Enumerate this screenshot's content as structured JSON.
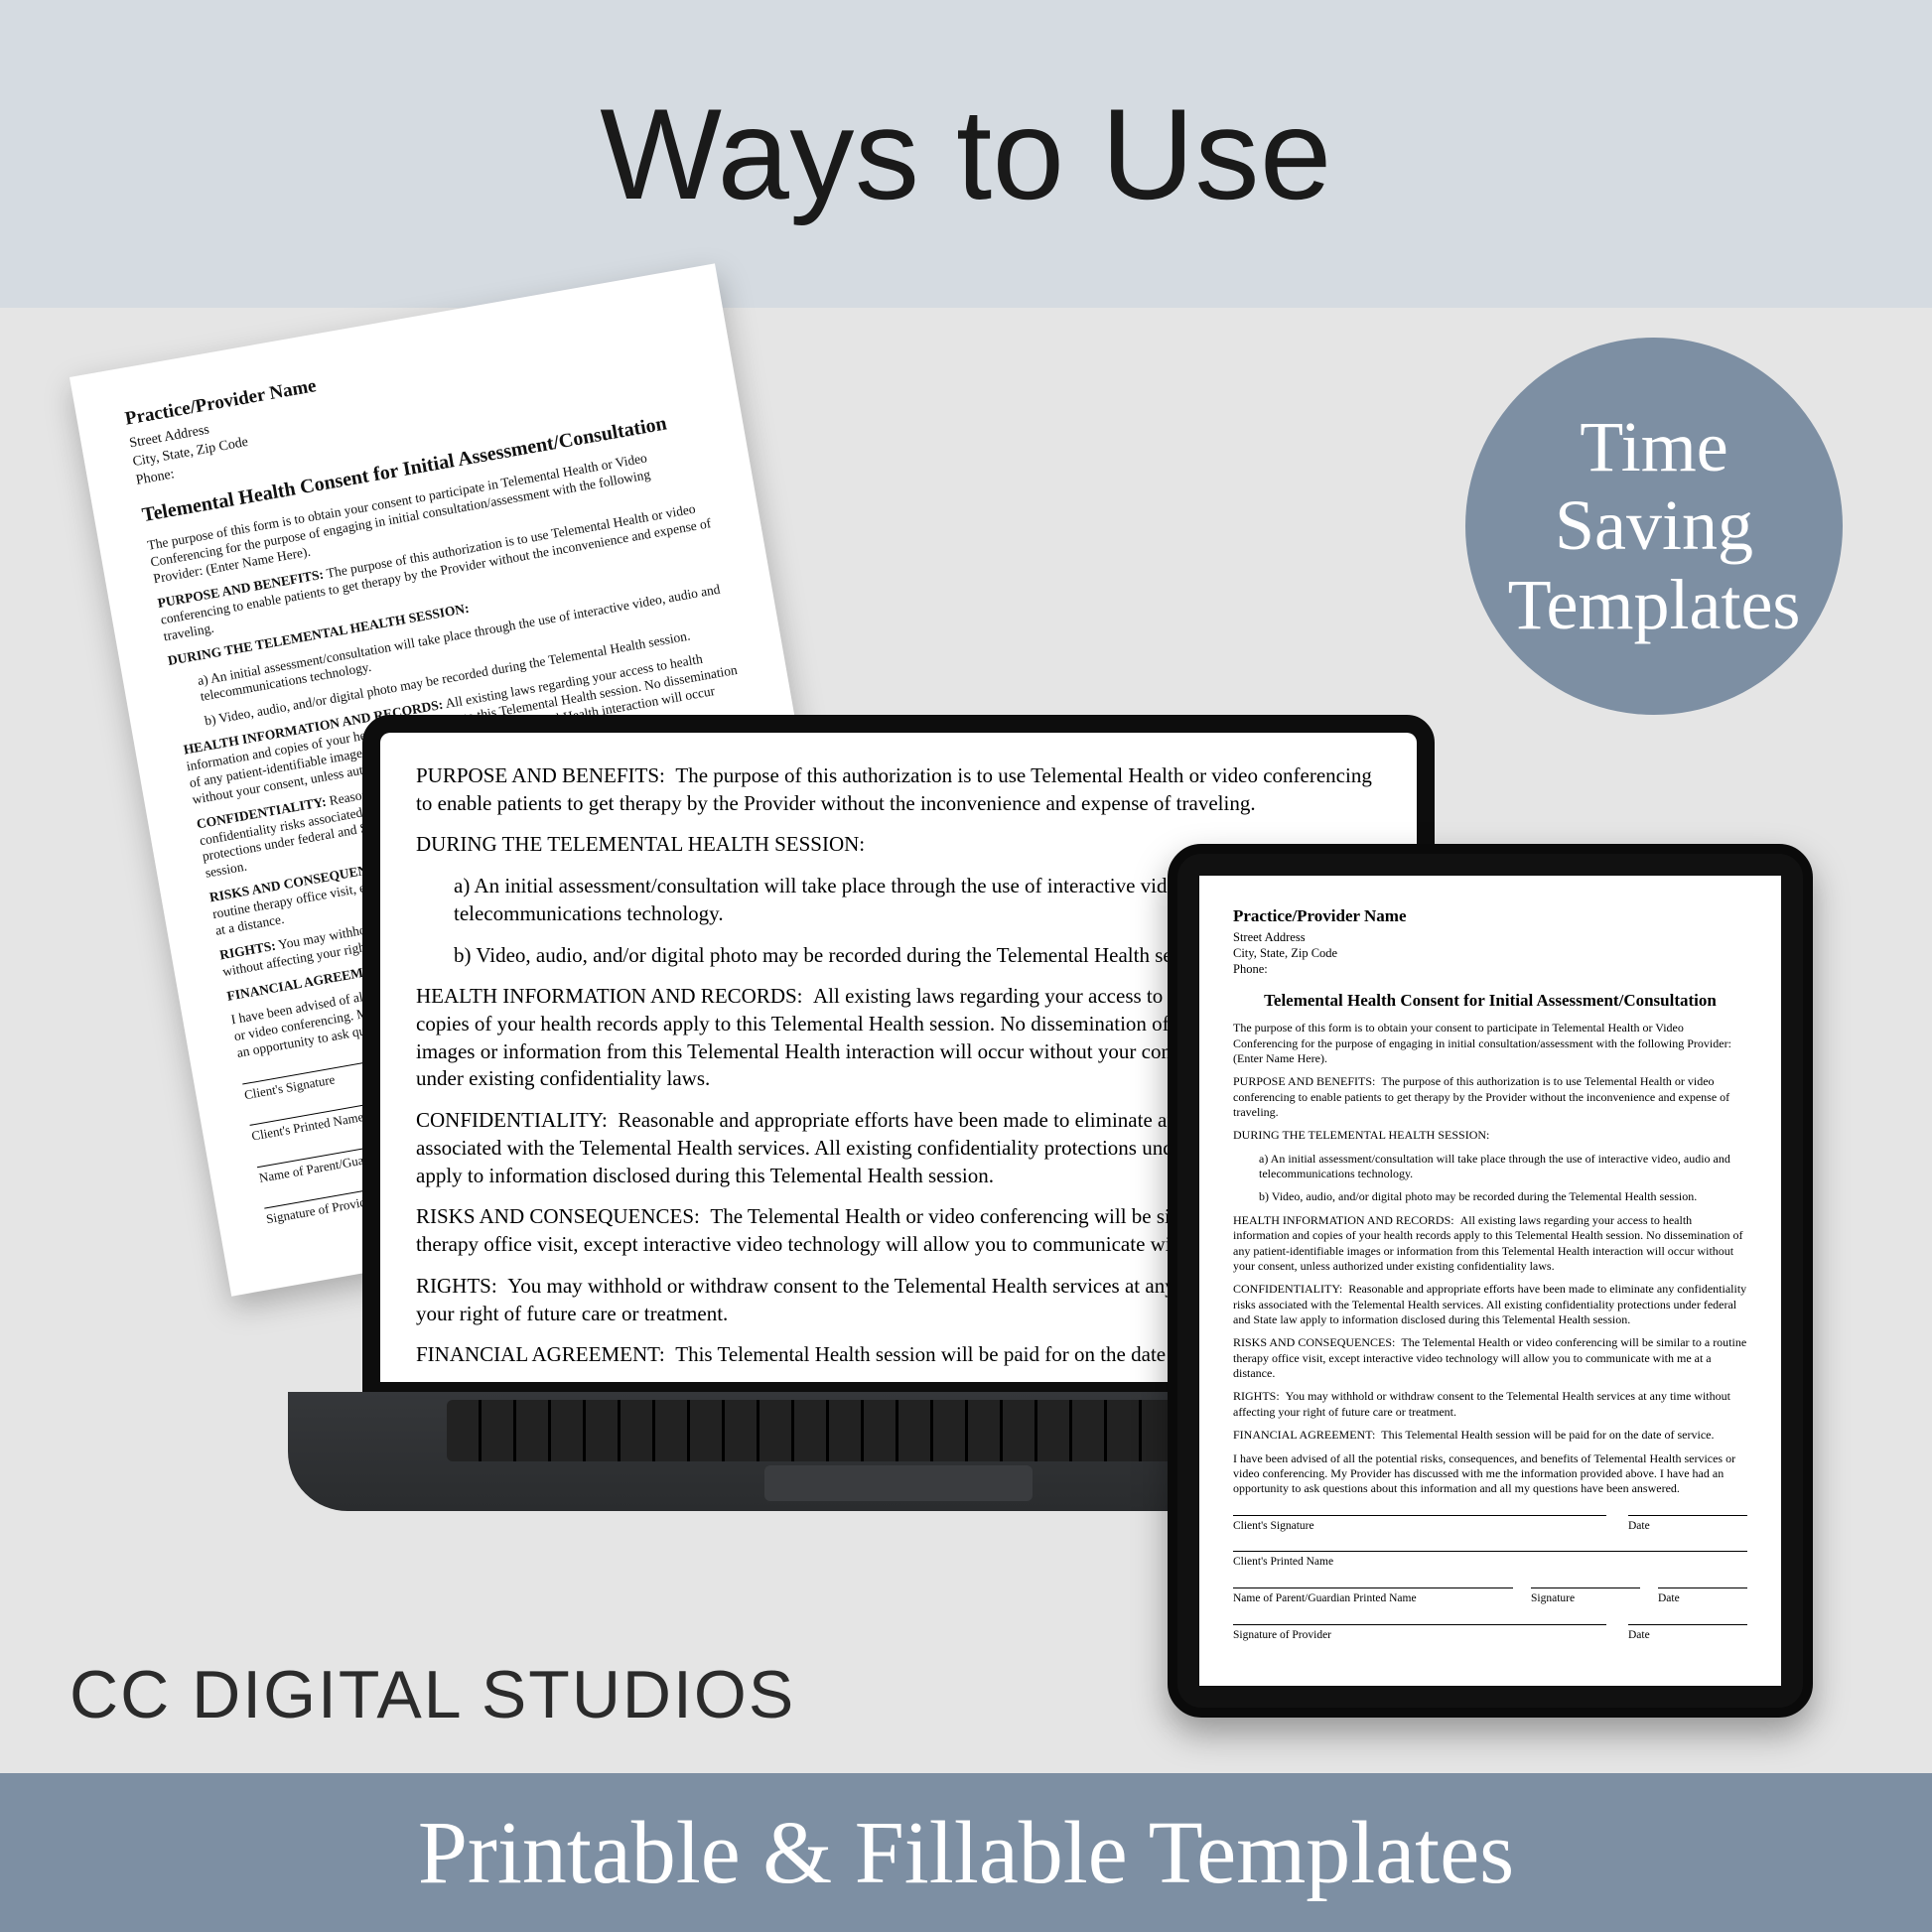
{
  "header": {
    "title": "Ways to Use"
  },
  "badge": {
    "line1": "Time",
    "line2": "Saving",
    "line3": "Templates"
  },
  "brand": "CC DIGITAL STUDIOS",
  "footer": "Printable & Fillable Templates",
  "doc": {
    "provider_heading": "Practice/Provider Name",
    "addr1": "Street Address",
    "addr2": "City, State, Zip Code",
    "addr3": "Phone:",
    "title": "Telemental Health Consent for Initial Assessment/Consultation",
    "intro": "The purpose of this form is to obtain your consent to participate in Telemental Health or Video Conferencing for the purpose of engaging in initial consultation/assessment with the following Provider: (Enter Name Here).",
    "purpose_label": "PURPOSE AND BENEFITS:",
    "purpose": "The purpose of this authorization is to use Telemental Health or video conferencing to enable patients to get therapy by the Provider without the inconvenience and expense of traveling.",
    "during_label": "DURING THE TELEMENTAL HEALTH SESSION:",
    "during_a": "a)  An initial assessment/consultation will take place through the use of interactive video, audio and telecommunications technology.",
    "during_b": "b)  Video, audio, and/or digital photo may be recorded during the Telemental Health session.",
    "records_label": "HEALTH INFORMATION AND RECORDS:",
    "records": "All existing laws regarding your access to health information and copies of your health records apply to this Telemental Health session.  No dissemination of any patient-identifiable images or information from this Telemental Health interaction will occur without your consent, unless authorized under existing confidentiality laws.",
    "conf_label": "CONFIDENTIALITY:",
    "conf": "Reasonable and appropriate efforts have been made to eliminate any confidentiality risks associated with the Telemental Health services. All existing confidentiality protections under federal and State law apply to information disclosed during this Telemental Health session.",
    "risks_label": "RISKS AND CONSEQUENCES:",
    "risks": "The Telemental Health or video conferencing will be similar to a routine therapy office visit, except interactive video technology will allow you to communicate with me at a distance.",
    "rights_label": "RIGHTS:",
    "rights": "You may withhold or withdraw consent to the Telemental Health services at any time without affecting your right of future care or treatment.",
    "fin_label": "FINANCIAL AGREEMENT:",
    "fin": "This Telemental Health session will be paid for on the date of service.",
    "ack": "I have been advised of all the potential risks, consequences, and benefits of Telemental Health services or video conferencing.  My Provider has discussed with me the information provided above.  I have had an opportunity to ask questions about this information and all my questions have been answered.",
    "sig_client": "Client's Signature",
    "sig_date": "Date",
    "sig_printed": "Client's Printed Name",
    "sig_parent": "Name of Parent/Guardian Printed Name",
    "sig_sig": "Signature",
    "sig_provider": "Signature of Provider"
  }
}
